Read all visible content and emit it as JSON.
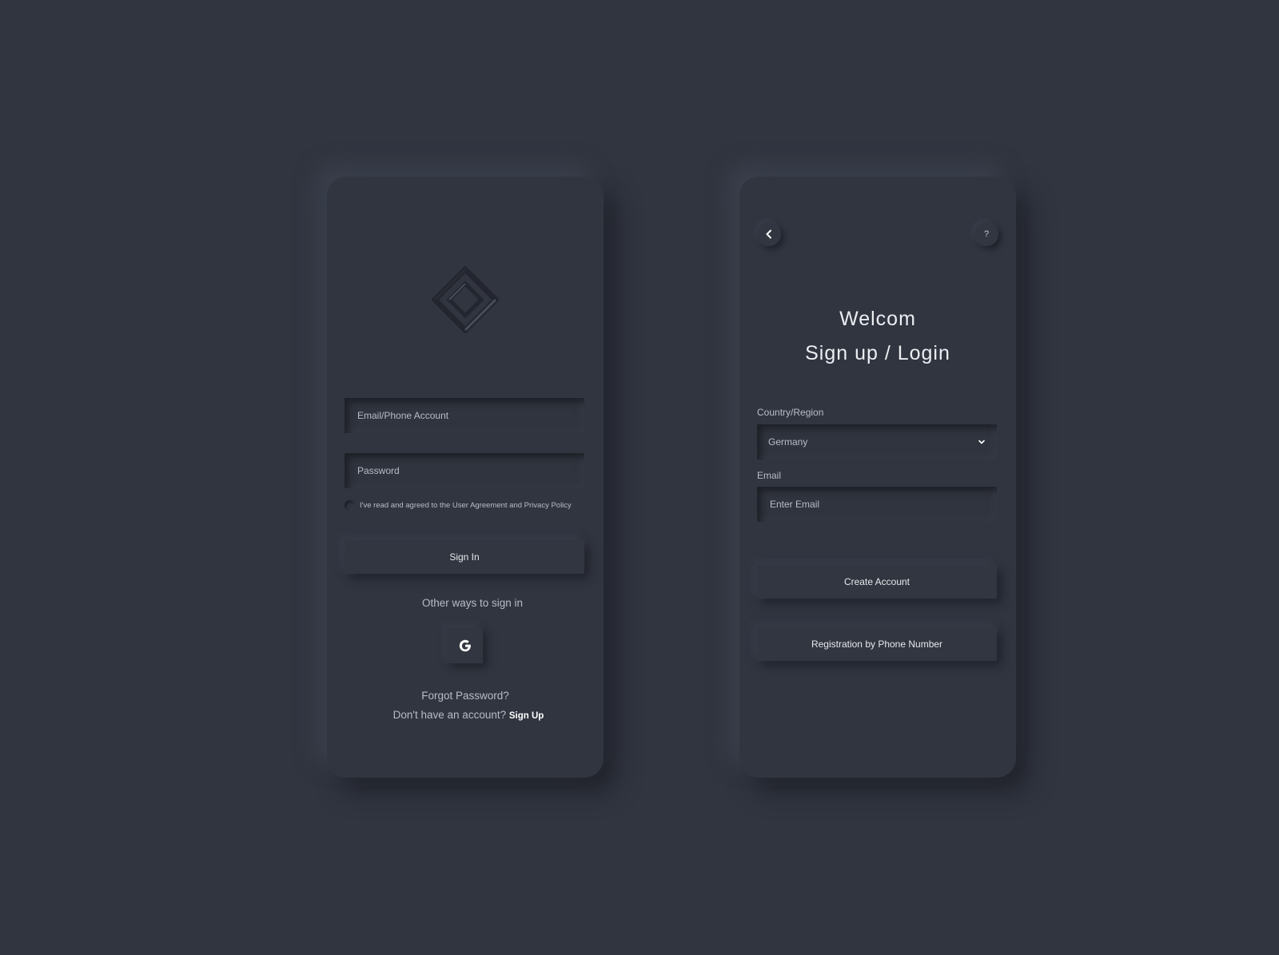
{
  "signin_card": {
    "email_placeholder": "Email/Phone Account",
    "password_placeholder": "Password",
    "agreement_text": "I've read and agreed to the User Agreement and Privacy Policy",
    "signin_label": "Sign In",
    "other_ways_text": "Other ways to sign in",
    "google_letter": "G",
    "forgot_password": "Forgot Password?",
    "no_account_text": "Don't have an account?",
    "signup_link": "Sign Up"
  },
  "register_card": {
    "help_label": "?",
    "title": "Welcom",
    "subtitle": "Sign up / Login",
    "country_label": "Country/Region",
    "country_value": "Germany",
    "email_label": "Email",
    "email_placeholder": "Enter Email",
    "create_account_label": "Create Account",
    "phone_registration_label": "Registration by Phone Number"
  },
  "icons": {
    "logo": "diamond-logo-icon",
    "google": "google-icon",
    "back": "chevron-left-icon",
    "dropdown": "chevron-down-icon"
  },
  "colors": {
    "background": "#313540",
    "text": "#b8bcc5",
    "highlight": "#ffffff"
  }
}
